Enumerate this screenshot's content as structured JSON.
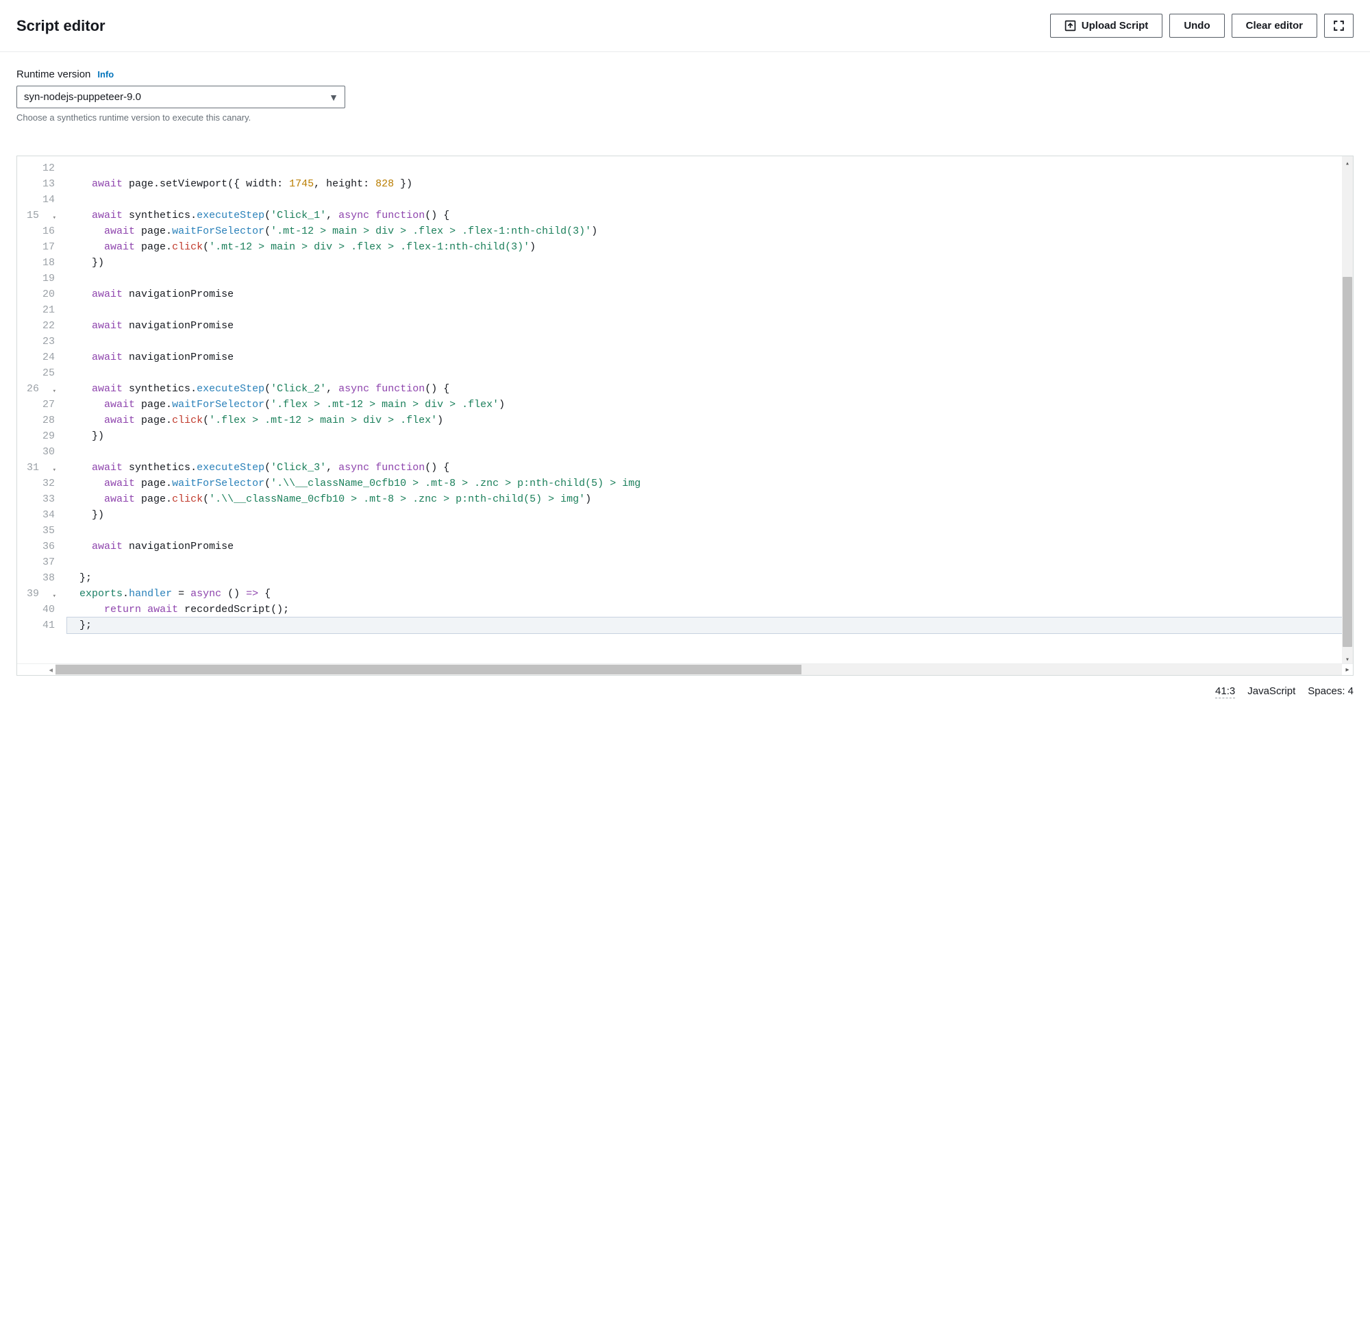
{
  "header": {
    "title": "Script editor",
    "buttons": {
      "upload": "Upload Script",
      "undo": "Undo",
      "clear": "Clear editor"
    }
  },
  "runtime": {
    "label": "Runtime version",
    "info": "Info",
    "value": "syn-nodejs-puppeteer-9.0",
    "hint": "Choose a synthetics runtime version to execute this canary."
  },
  "editor": {
    "startLine": 12,
    "foldLines": [
      15,
      26,
      31,
      39
    ],
    "activeLine": 41,
    "lines": [
      {
        "n": 12,
        "tokens": []
      },
      {
        "n": 13,
        "tokens": [
          {
            "t": "    ",
            "c": ""
          },
          {
            "t": "await",
            "c": "tok-kw"
          },
          {
            "t": " page.setViewport({ width: ",
            "c": ""
          },
          {
            "t": "1745",
            "c": "tok-num"
          },
          {
            "t": ", height: ",
            "c": ""
          },
          {
            "t": "828",
            "c": "tok-num"
          },
          {
            "t": " })",
            "c": ""
          }
        ]
      },
      {
        "n": 14,
        "tokens": []
      },
      {
        "n": 15,
        "tokens": [
          {
            "t": "    ",
            "c": ""
          },
          {
            "t": "await",
            "c": "tok-kw"
          },
          {
            "t": " synthetics.",
            "c": ""
          },
          {
            "t": "executeStep",
            "c": "tok-method"
          },
          {
            "t": "(",
            "c": ""
          },
          {
            "t": "'Click_1'",
            "c": "tok-str"
          },
          {
            "t": ", ",
            "c": ""
          },
          {
            "t": "async",
            "c": "tok-kw"
          },
          {
            "t": " ",
            "c": ""
          },
          {
            "t": "function",
            "c": "tok-kw"
          },
          {
            "t": "() {",
            "c": ""
          }
        ]
      },
      {
        "n": 16,
        "tokens": [
          {
            "t": "      ",
            "c": ""
          },
          {
            "t": "await",
            "c": "tok-kw"
          },
          {
            "t": " page.",
            "c": ""
          },
          {
            "t": "waitForSelector",
            "c": "tok-method"
          },
          {
            "t": "(",
            "c": ""
          },
          {
            "t": "'.mt-12 > main > div > .flex > .flex-1:nth-child(3)'",
            "c": "tok-str"
          },
          {
            "t": ")",
            "c": ""
          }
        ]
      },
      {
        "n": 17,
        "tokens": [
          {
            "t": "      ",
            "c": ""
          },
          {
            "t": "await",
            "c": "tok-kw"
          },
          {
            "t": " page.",
            "c": ""
          },
          {
            "t": "click",
            "c": "tok-call"
          },
          {
            "t": "(",
            "c": ""
          },
          {
            "t": "'.mt-12 > main > div > .flex > .flex-1:nth-child(3)'",
            "c": "tok-str"
          },
          {
            "t": ")",
            "c": ""
          }
        ]
      },
      {
        "n": 18,
        "tokens": [
          {
            "t": "    })",
            "c": ""
          }
        ]
      },
      {
        "n": 19,
        "tokens": []
      },
      {
        "n": 20,
        "tokens": [
          {
            "t": "    ",
            "c": ""
          },
          {
            "t": "await",
            "c": "tok-kw"
          },
          {
            "t": " navigationPromise",
            "c": ""
          }
        ]
      },
      {
        "n": 21,
        "tokens": []
      },
      {
        "n": 22,
        "tokens": [
          {
            "t": "    ",
            "c": ""
          },
          {
            "t": "await",
            "c": "tok-kw"
          },
          {
            "t": " navigationPromise",
            "c": ""
          }
        ]
      },
      {
        "n": 23,
        "tokens": []
      },
      {
        "n": 24,
        "tokens": [
          {
            "t": "    ",
            "c": ""
          },
          {
            "t": "await",
            "c": "tok-kw"
          },
          {
            "t": " navigationPromise",
            "c": ""
          }
        ]
      },
      {
        "n": 25,
        "tokens": []
      },
      {
        "n": 26,
        "tokens": [
          {
            "t": "    ",
            "c": ""
          },
          {
            "t": "await",
            "c": "tok-kw"
          },
          {
            "t": " synthetics.",
            "c": ""
          },
          {
            "t": "executeStep",
            "c": "tok-method"
          },
          {
            "t": "(",
            "c": ""
          },
          {
            "t": "'Click_2'",
            "c": "tok-str"
          },
          {
            "t": ", ",
            "c": ""
          },
          {
            "t": "async",
            "c": "tok-kw"
          },
          {
            "t": " ",
            "c": ""
          },
          {
            "t": "function",
            "c": "tok-kw"
          },
          {
            "t": "() {",
            "c": ""
          }
        ]
      },
      {
        "n": 27,
        "tokens": [
          {
            "t": "      ",
            "c": ""
          },
          {
            "t": "await",
            "c": "tok-kw"
          },
          {
            "t": " page.",
            "c": ""
          },
          {
            "t": "waitForSelector",
            "c": "tok-method"
          },
          {
            "t": "(",
            "c": ""
          },
          {
            "t": "'.flex > .mt-12 > main > div > .flex'",
            "c": "tok-str"
          },
          {
            "t": ")",
            "c": ""
          }
        ]
      },
      {
        "n": 28,
        "tokens": [
          {
            "t": "      ",
            "c": ""
          },
          {
            "t": "await",
            "c": "tok-kw"
          },
          {
            "t": " page.",
            "c": ""
          },
          {
            "t": "click",
            "c": "tok-call"
          },
          {
            "t": "(",
            "c": ""
          },
          {
            "t": "'.flex > .mt-12 > main > div > .flex'",
            "c": "tok-str"
          },
          {
            "t": ")",
            "c": ""
          }
        ]
      },
      {
        "n": 29,
        "tokens": [
          {
            "t": "    })",
            "c": ""
          }
        ]
      },
      {
        "n": 30,
        "tokens": []
      },
      {
        "n": 31,
        "tokens": [
          {
            "t": "    ",
            "c": ""
          },
          {
            "t": "await",
            "c": "tok-kw"
          },
          {
            "t": " synthetics.",
            "c": ""
          },
          {
            "t": "executeStep",
            "c": "tok-method"
          },
          {
            "t": "(",
            "c": ""
          },
          {
            "t": "'Click_3'",
            "c": "tok-str"
          },
          {
            "t": ", ",
            "c": ""
          },
          {
            "t": "async",
            "c": "tok-kw"
          },
          {
            "t": " ",
            "c": ""
          },
          {
            "t": "function",
            "c": "tok-kw"
          },
          {
            "t": "() {",
            "c": ""
          }
        ]
      },
      {
        "n": 32,
        "tokens": [
          {
            "t": "      ",
            "c": ""
          },
          {
            "t": "await",
            "c": "tok-kw"
          },
          {
            "t": " page.",
            "c": ""
          },
          {
            "t": "waitForSelector",
            "c": "tok-method"
          },
          {
            "t": "(",
            "c": ""
          },
          {
            "t": "'.\\\\__className_0cfb10 > .mt-8 > .znc > p:nth-child(5) > img",
            "c": "tok-str"
          }
        ]
      },
      {
        "n": 33,
        "tokens": [
          {
            "t": "      ",
            "c": ""
          },
          {
            "t": "await",
            "c": "tok-kw"
          },
          {
            "t": " page.",
            "c": ""
          },
          {
            "t": "click",
            "c": "tok-call"
          },
          {
            "t": "(",
            "c": ""
          },
          {
            "t": "'.\\\\__className_0cfb10 > .mt-8 > .znc > p:nth-child(5) > img'",
            "c": "tok-str"
          },
          {
            "t": ")",
            "c": ""
          }
        ]
      },
      {
        "n": 34,
        "tokens": [
          {
            "t": "    })",
            "c": ""
          }
        ]
      },
      {
        "n": 35,
        "tokens": []
      },
      {
        "n": 36,
        "tokens": [
          {
            "t": "    ",
            "c": ""
          },
          {
            "t": "await",
            "c": "tok-kw"
          },
          {
            "t": " navigationPromise",
            "c": ""
          }
        ]
      },
      {
        "n": 37,
        "tokens": []
      },
      {
        "n": 38,
        "tokens": [
          {
            "t": "  };",
            "c": ""
          }
        ]
      },
      {
        "n": 39,
        "tokens": [
          {
            "t": "  ",
            "c": ""
          },
          {
            "t": "exports",
            "c": "tok-this"
          },
          {
            "t": ".",
            "c": ""
          },
          {
            "t": "handler",
            "c": "tok-method"
          },
          {
            "t": " = ",
            "c": ""
          },
          {
            "t": "async",
            "c": "tok-kw"
          },
          {
            "t": " () ",
            "c": ""
          },
          {
            "t": "=>",
            "c": "tok-kw"
          },
          {
            "t": " {",
            "c": ""
          }
        ]
      },
      {
        "n": 40,
        "tokens": [
          {
            "t": "      ",
            "c": ""
          },
          {
            "t": "return",
            "c": "tok-kw"
          },
          {
            "t": " ",
            "c": ""
          },
          {
            "t": "await",
            "c": "tok-kw"
          },
          {
            "t": " recordedScript();",
            "c": ""
          }
        ]
      },
      {
        "n": 41,
        "tokens": [
          {
            "t": "  };",
            "c": ""
          }
        ]
      }
    ]
  },
  "status": {
    "position": "41:3",
    "language": "JavaScript",
    "indent": "Spaces: 4"
  }
}
